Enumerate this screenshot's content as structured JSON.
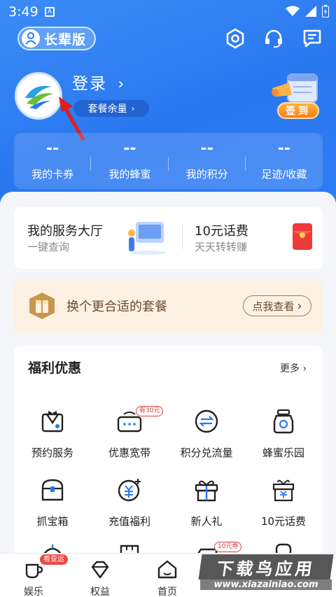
{
  "status": {
    "time": "3:49",
    "notif_letter": "A"
  },
  "header": {
    "elder_mode_label": "长辈版",
    "login_label": "登录",
    "plan_balance_label": "套餐余量",
    "checkin_label": "签到"
  },
  "stats": [
    {
      "value": "--",
      "label": "我的卡券"
    },
    {
      "value": "--",
      "label": "我的蜂蜜"
    },
    {
      "value": "--",
      "label": "我的积分"
    },
    {
      "value": "--",
      "label": "足迹/收藏"
    }
  ],
  "services": {
    "left_title": "我的服务大厅",
    "left_sub": "一键查询",
    "right_title": "10元话费",
    "right_sub": "天天转转赚"
  },
  "promo": {
    "text": "换个更合适的套餐",
    "button": "点我查看"
  },
  "benefits": {
    "title": "福利优惠",
    "more": "更多",
    "items": [
      {
        "label": "预约服务",
        "tag": ""
      },
      {
        "label": "优惠宽带",
        "tag": "有30元"
      },
      {
        "label": "积分兑流量",
        "tag": ""
      },
      {
        "label": "蜂蜜乐园",
        "tag": ""
      },
      {
        "label": "抓宝箱",
        "tag": ""
      },
      {
        "label": "充值福利",
        "tag": ""
      },
      {
        "label": "新人礼",
        "tag": ""
      },
      {
        "label": "10元话费",
        "tag": ""
      }
    ],
    "row3_tag": "10元券"
  },
  "tabbar": {
    "items": [
      {
        "label": "娱乐",
        "badge": "看亚运"
      },
      {
        "label": "权益",
        "badge": ""
      },
      {
        "label": "首页",
        "badge": ""
      }
    ]
  },
  "watermark": {
    "title": "下载鸟应用",
    "url": "www.xiazainiao.com"
  },
  "colors": {
    "primary": "#2a78f0",
    "accent": "#ff7d1a",
    "promo_bg": "#fdf1e4",
    "badge": "#f04545"
  }
}
